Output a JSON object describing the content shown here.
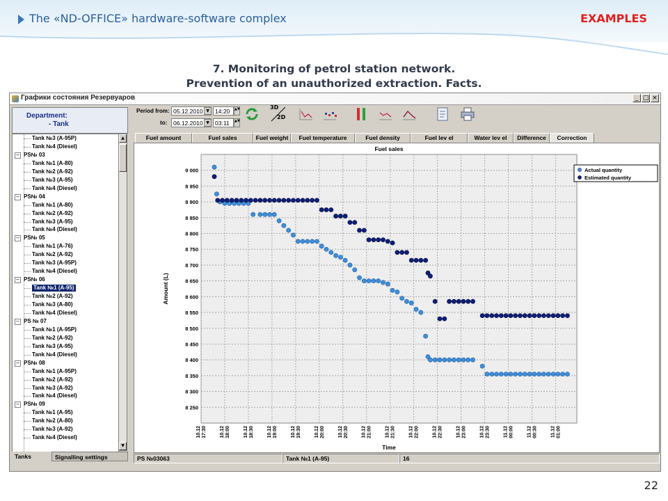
{
  "slide": {
    "header_title": "The «ND-OFFICE» hardware-software complex",
    "header_section": "EXAMPLES",
    "title_line1": "7. Monitoring of petrol station network.",
    "title_line2": "Prevention of an unauthorized extraction. Facts.",
    "page_number": "22"
  },
  "window": {
    "title": "Графики состояния Резервуаров",
    "minimize": "_",
    "maximize": "□",
    "close": "×"
  },
  "left_panel": {
    "department_label": "Department:",
    "department_value": "- Tank",
    "tree": [
      {
        "text": "Tank №3 (A-95P)",
        "level": 2
      },
      {
        "text": "Tank №4 (Diesel)",
        "level": 2
      },
      {
        "text": "PS№ 03",
        "level": 1
      },
      {
        "text": "Tank №1 (A-80)",
        "level": 2
      },
      {
        "text": "Tank №2 (A-92)",
        "level": 2
      },
      {
        "text": "Tank №3 (A-95)",
        "level": 2
      },
      {
        "text": "Tank №4 (Diesel)",
        "level": 2
      },
      {
        "text": "PS№ 04",
        "level": 1
      },
      {
        "text": "Tank №1 (A-80)",
        "level": 2
      },
      {
        "text": "Tank №2 (A-92)",
        "level": 2
      },
      {
        "text": "Tank №3 (A-95)",
        "level": 2
      },
      {
        "text": "Tank №4 (Diesel)",
        "level": 2
      },
      {
        "text": "PS№ 05",
        "level": 1
      },
      {
        "text": "Tank №1 (A-76)",
        "level": 2
      },
      {
        "text": "Tank №2 (A-92)",
        "level": 2
      },
      {
        "text": "Tank №3 (A-95P)",
        "level": 2
      },
      {
        "text": "Tank №4 (Diesel)",
        "level": 2
      },
      {
        "text": "PS№ 06",
        "level": 1
      },
      {
        "text": "Tank №1 (A-95)",
        "level": 2,
        "selected": true
      },
      {
        "text": "Tank №2 (A-92)",
        "level": 2
      },
      {
        "text": "Tank №3 (A-80)",
        "level": 2
      },
      {
        "text": "Tank №4 (Diesel)",
        "level": 2
      },
      {
        "text": "PS № 07",
        "level": 1
      },
      {
        "text": "Tank №1 (A-95P)",
        "level": 2
      },
      {
        "text": "Tank №2 (A-92)",
        "level": 2
      },
      {
        "text": "Tank №3 (A-95)",
        "level": 2
      },
      {
        "text": "Tank №4 (Diesel)",
        "level": 2
      },
      {
        "text": "PS№ 08",
        "level": 1
      },
      {
        "text": "Tank №1 (A-95P)",
        "level": 2
      },
      {
        "text": "Tank №2 (A-92)",
        "level": 2
      },
      {
        "text": "Tank №3 (A-92)",
        "level": 2
      },
      {
        "text": "Tank №4 (Diesel)",
        "level": 2
      },
      {
        "text": "PS№ 09",
        "level": 1
      },
      {
        "text": "Tank №1 (A-95)",
        "level": 2
      },
      {
        "text": "Tank №2 (A-80)",
        "level": 2
      },
      {
        "text": "Tank №3 (A-92)",
        "level": 2
      },
      {
        "text": "Tank №4 (Diesel)",
        "level": 2
      }
    ],
    "tabs": [
      "Tanks",
      "Signalling settings"
    ]
  },
  "toolbar": {
    "period_from_label": "Period from:",
    "period_to_label": "to:",
    "from_date": "05.12.2010",
    "from_time": "14:20",
    "to_date": "06.12.2010",
    "to_time": "03:11",
    "mode_3d": "3D",
    "mode_2d": "2D"
  },
  "tabs": [
    "Fuel amount",
    "Fuel sales",
    "Fuel weight",
    "Fuel temperature",
    "Fuel density",
    "Fuel lev el",
    "Water lev el",
    "Difference",
    "Correction"
  ],
  "active_tab": "Fuel sales",
  "status_bar": {
    "station": "PS №03063",
    "tank": "Tank №1 (A-95)",
    "count": "16"
  },
  "colors": {
    "actual": "#3f8fd8",
    "estimated": "#0e1f7a",
    "accent_red": "#e0201e",
    "header_blue": "#2b5f99"
  },
  "chart_data": {
    "type": "scatter",
    "title": "Fuel sales",
    "xlabel": "Time",
    "ylabel": "Amount (L)",
    "ylim": [
      8200,
      9050
    ],
    "yticks": [
      8250,
      8300,
      8350,
      8400,
      8450,
      8500,
      8550,
      8600,
      8650,
      8700,
      8750,
      8800,
      8850,
      8900,
      8950,
      9000
    ],
    "ytick_labels": [
      "8 250",
      "8 300",
      "8 350",
      "8 400",
      "8 450",
      "8 500",
      "8 550",
      "8 600",
      "8 650",
      "8 700",
      "8 750",
      "8 800",
      "8 850",
      "8 900",
      "8 950",
      "9 000"
    ],
    "xticks": [
      {
        "date": "10.12",
        "time": "17:30"
      },
      {
        "date": "10.12",
        "time": "18:00"
      },
      {
        "date": "10.12",
        "time": "18:30"
      },
      {
        "date": "10.12",
        "time": "19:00"
      },
      {
        "date": "10.12",
        "time": "19:30"
      },
      {
        "date": "10.12",
        "time": "20:00"
      },
      {
        "date": "10.12",
        "time": "20:30"
      },
      {
        "date": "10.12",
        "time": "21:00"
      },
      {
        "date": "10.12",
        "time": "21:30"
      },
      {
        "date": "10.12",
        "time": "22:00"
      },
      {
        "date": "10.12",
        "time": "22:30"
      },
      {
        "date": "10.12",
        "time": "23:00"
      },
      {
        "date": "10.12",
        "time": "23:30"
      },
      {
        "date": "11.12",
        "time": "00:00"
      },
      {
        "date": "11.12",
        "time": "00:30"
      },
      {
        "date": "11.12",
        "time": "01:00"
      }
    ],
    "legend_position": "top-right",
    "grid": true,
    "series": [
      {
        "name": "Actual quantity",
        "color": "#3f8fd8",
        "x": [
          17.78,
          17.83,
          17.9,
          18.0,
          18.1,
          18.2,
          18.3,
          18.4,
          18.5,
          18.6,
          18.75,
          18.85,
          18.95,
          19.05,
          19.15,
          19.25,
          19.35,
          19.45,
          19.55,
          19.65,
          19.75,
          19.85,
          19.95,
          20.05,
          20.15,
          20.25,
          20.35,
          20.45,
          20.55,
          20.65,
          20.75,
          20.85,
          20.95,
          21.05,
          21.15,
          21.25,
          21.35,
          21.45,
          21.55,
          21.65,
          21.75,
          21.85,
          21.95,
          22.05,
          22.15,
          22.25,
          22.3,
          22.35,
          22.45,
          22.55,
          22.65,
          22.75,
          22.85,
          22.95,
          23.05,
          23.15,
          23.25,
          23.45,
          23.55,
          23.65,
          23.75,
          23.85,
          23.95,
          24.05,
          24.15,
          24.25,
          24.35,
          24.45,
          24.55,
          24.65,
          24.75,
          24.85,
          24.95,
          25.05,
          25.15,
          25.25
        ],
        "y": [
          9010,
          8925,
          8900,
          8895,
          8895,
          8895,
          8895,
          8895,
          8895,
          8860,
          8860,
          8860,
          8860,
          8860,
          8840,
          8825,
          8810,
          8795,
          8775,
          8775,
          8775,
          8775,
          8775,
          8760,
          8750,
          8740,
          8730,
          8725,
          8715,
          8700,
          8685,
          8660,
          8650,
          8650,
          8650,
          8650,
          8645,
          8640,
          8620,
          8615,
          8595,
          8585,
          8580,
          8560,
          8550,
          8475,
          8410,
          8400,
          8400,
          8400,
          8400,
          8400,
          8400,
          8400,
          8400,
          8400,
          8400,
          8380,
          8355,
          8355,
          8355,
          8355,
          8355,
          8355,
          8355,
          8355,
          8355,
          8355,
          8355,
          8355,
          8355,
          8355,
          8355,
          8355,
          8355,
          8355
        ]
      },
      {
        "name": "Estimated quantity",
        "color": "#0e1f7a",
        "x": [
          17.78,
          17.85,
          17.95,
          18.05,
          18.15,
          18.25,
          18.35,
          18.45,
          18.55,
          18.65,
          18.75,
          18.85,
          18.95,
          19.05,
          19.15,
          19.25,
          19.35,
          19.45,
          19.55,
          19.65,
          19.75,
          19.85,
          19.95,
          20.05,
          20.15,
          20.25,
          20.35,
          20.45,
          20.55,
          20.65,
          20.75,
          20.85,
          20.95,
          21.05,
          21.15,
          21.25,
          21.35,
          21.45,
          21.55,
          21.65,
          21.75,
          21.85,
          21.95,
          22.05,
          22.15,
          22.25,
          22.3,
          22.35,
          22.45,
          22.55,
          22.65,
          22.75,
          22.85,
          22.95,
          23.05,
          23.15,
          23.25,
          23.45,
          23.55,
          23.65,
          23.75,
          23.85,
          23.95,
          24.05,
          24.15,
          24.25,
          24.35,
          24.45,
          24.55,
          24.65,
          24.75,
          24.85,
          24.95,
          25.05,
          25.15,
          25.25
        ],
        "y": [
          8980,
          8905,
          8905,
          8905,
          8905,
          8905,
          8905,
          8905,
          8905,
          8905,
          8905,
          8905,
          8905,
          8905,
          8905,
          8905,
          8905,
          8905,
          8905,
          8905,
          8905,
          8905,
          8905,
          8875,
          8875,
          8875,
          8855,
          8855,
          8855,
          8835,
          8835,
          8810,
          8810,
          8780,
          8780,
          8780,
          8780,
          8775,
          8770,
          8740,
          8740,
          8740,
          8715,
          8715,
          8715,
          8715,
          8675,
          8665,
          8585,
          8530,
          8530,
          8585,
          8585,
          8585,
          8585,
          8585,
          8585,
          8540,
          8540,
          8540,
          8540,
          8540,
          8540,
          8540,
          8540,
          8540,
          8540,
          8540,
          8540,
          8540,
          8540,
          8540,
          8540,
          8540,
          8540,
          8540
        ]
      }
    ]
  }
}
